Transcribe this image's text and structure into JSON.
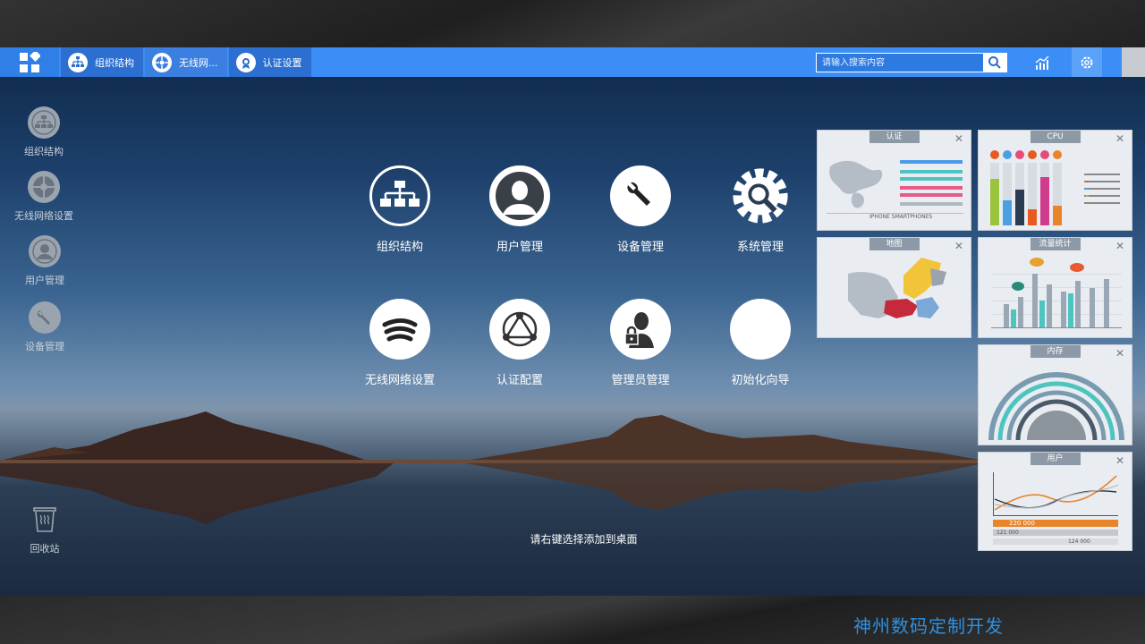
{
  "taskbar": {
    "tabs": [
      {
        "label": "组织结构"
      },
      {
        "label": "无线网..."
      },
      {
        "label": "认证设置"
      }
    ],
    "search_placeholder": "请输入搜索内容"
  },
  "sidebar": {
    "items": [
      {
        "label": "组织结构",
        "icon": "org-chart-icon"
      },
      {
        "label": "无线网络设置",
        "icon": "wireless-icon"
      },
      {
        "label": "用户管理",
        "icon": "user-icon"
      },
      {
        "label": "设备管理",
        "icon": "wrench-icon"
      }
    ],
    "recycle": {
      "label": "回收站",
      "icon": "trash-icon"
    }
  },
  "apps": [
    {
      "label": "组织结构",
      "icon": "org-chart-icon"
    },
    {
      "label": "用户管理",
      "icon": "user-icon"
    },
    {
      "label": "设备管理",
      "icon": "wrench-icon"
    },
    {
      "label": "系统管理",
      "icon": "gear-icon"
    },
    {
      "label": "无线网络设置",
      "icon": "wireless-icon"
    },
    {
      "label": "认证配置",
      "icon": "network-icon"
    },
    {
      "label": "管理员管理",
      "icon": "admin-lock-icon"
    },
    {
      "label": "初始化向导",
      "icon": "compass-icon"
    }
  ],
  "hint": "请右键选择添加到桌面",
  "widgets": [
    {
      "title": "认证",
      "footer": "IPHONE    SMARTPHONES"
    },
    {
      "title": "CPU"
    },
    {
      "title": "地图"
    },
    {
      "title": "流量统计"
    },
    {
      "title": "内存"
    },
    {
      "title": "用户",
      "rows": [
        "220 000",
        "121 000",
        "124 000"
      ]
    }
  ],
  "close_glyph": "✕",
  "brand": "神州数码定制开发",
  "colors": {
    "taskbar": "#3a8ef6",
    "brand": "#2f8fe0"
  }
}
